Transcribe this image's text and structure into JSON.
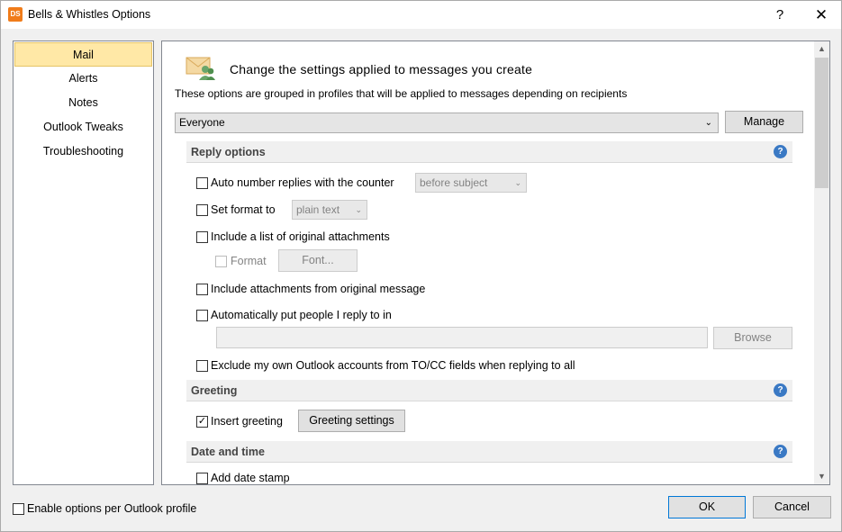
{
  "window": {
    "app_icon_text": "DS",
    "title": "Bells & Whistles Options",
    "help_glyph": "?",
    "close_glyph": "✕"
  },
  "nav": {
    "items": [
      {
        "label": "Mail",
        "active": true
      },
      {
        "label": "Alerts",
        "active": false
      },
      {
        "label": "Notes",
        "active": false
      },
      {
        "label": "Outlook Tweaks",
        "active": false
      },
      {
        "label": "Troubleshooting",
        "active": false
      }
    ]
  },
  "header": {
    "title": "Change the settings applied to messages you create",
    "subtitle": "These options are grouped in profiles that will be applied to messages depending on recipients"
  },
  "profile": {
    "selected": "Everyone",
    "manage_label": "Manage"
  },
  "sections": {
    "reply": {
      "title": "Reply options",
      "auto_number": {
        "label": "Auto number replies with the counter",
        "checked": false,
        "dropdown": "before subject"
      },
      "set_format": {
        "label": "Set format to",
        "checked": false,
        "dropdown": "plain text"
      },
      "include_list": {
        "label": "Include a list of original attachments",
        "checked": false
      },
      "format": {
        "label": "Format",
        "checked": false,
        "font_button": "Font..."
      },
      "include_attachments": {
        "label": "Include attachments from original message",
        "checked": false
      },
      "auto_put": {
        "label": "Automatically put people I reply to in",
        "checked": false,
        "path_value": "",
        "browse_label": "Browse"
      },
      "exclude_accounts": {
        "label": "Exclude my own Outlook accounts from TO/CC fields when replying to all",
        "checked": false
      }
    },
    "greeting": {
      "title": "Greeting",
      "insert": {
        "label": "Insert greeting",
        "checked": true,
        "settings_button": "Greeting settings"
      }
    },
    "datetime": {
      "title": "Date and time",
      "add_stamp": {
        "label": "Add date stamp",
        "checked": false
      }
    }
  },
  "footer": {
    "enable_per_profile": {
      "label": "Enable options per Outlook profile",
      "checked": false
    },
    "ok_label": "OK",
    "cancel_label": "Cancel"
  },
  "colors": {
    "nav_active_bg": "#ffe8a6",
    "help_icon": "#3a79c4",
    "ok_border": "#0078d7"
  }
}
